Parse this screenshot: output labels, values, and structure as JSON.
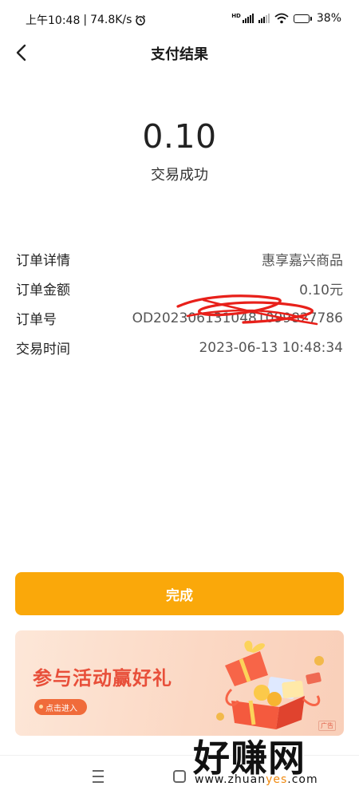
{
  "status_bar": {
    "time": "上午10:48",
    "net_speed": "74.8K/s",
    "battery_percent": "38%",
    "battery_level": 0.38,
    "icons": [
      "alarm-icon",
      "hd-icon",
      "cell-signal-icon",
      "wifi-icon",
      "battery-icon"
    ]
  },
  "nav": {
    "title": "支付结果",
    "back_icon": "chevron-left-icon"
  },
  "result": {
    "amount": "0.10",
    "status": "交易成功"
  },
  "details": [
    {
      "label": "订单详情",
      "value": "惠享嘉兴商品"
    },
    {
      "label": "订单金额",
      "value": "0.10元"
    },
    {
      "label": "订单号",
      "value": "OD2023061310481099827786"
    },
    {
      "label": "交易时间",
      "value": "2023-06-13 10:48:34"
    }
  ],
  "done_button": "完成",
  "banner": {
    "title": "参与活动赢好礼",
    "button": "点击进入",
    "ad_tag": "广告",
    "accent": "#e84f3a"
  },
  "watermark": {
    "main": "好赚网",
    "sub_prefix": "www.zhuan",
    "sub_highlight": "yes",
    "sub_suffix": ".com"
  },
  "colors": {
    "primary_button": "#faa80a",
    "scribble": "#e8201a"
  }
}
